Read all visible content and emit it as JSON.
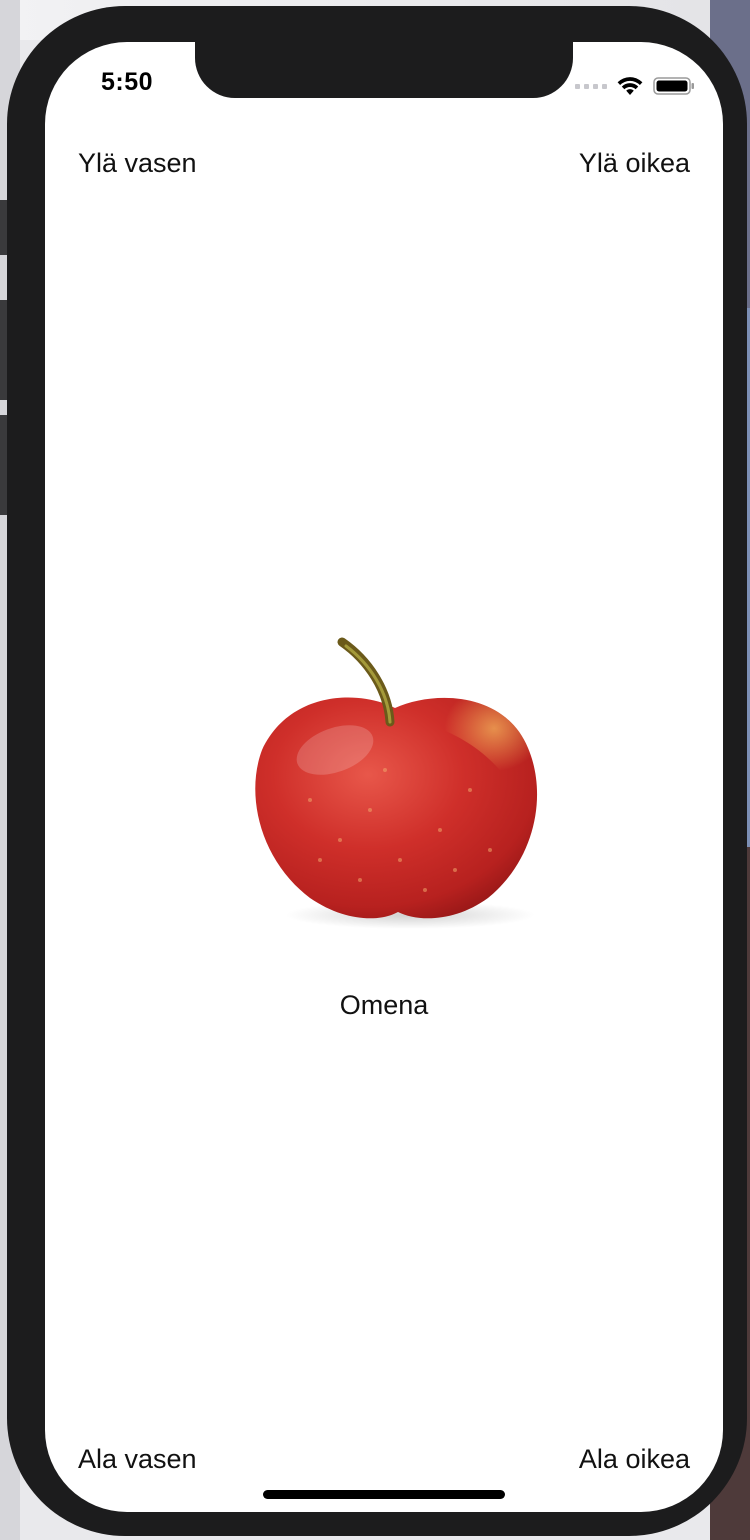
{
  "status_bar": {
    "time": "5:50"
  },
  "labels": {
    "top_left": "Ylä vasen",
    "top_right": "Ylä oikea",
    "bottom_left": "Ala vasen",
    "bottom_right": "Ala oikea"
  },
  "center": {
    "caption": "Omena",
    "image": "apple-image"
  },
  "colors": {
    "frame": "#1c1c1d",
    "screen": "#ffffff",
    "text": "#111111"
  }
}
